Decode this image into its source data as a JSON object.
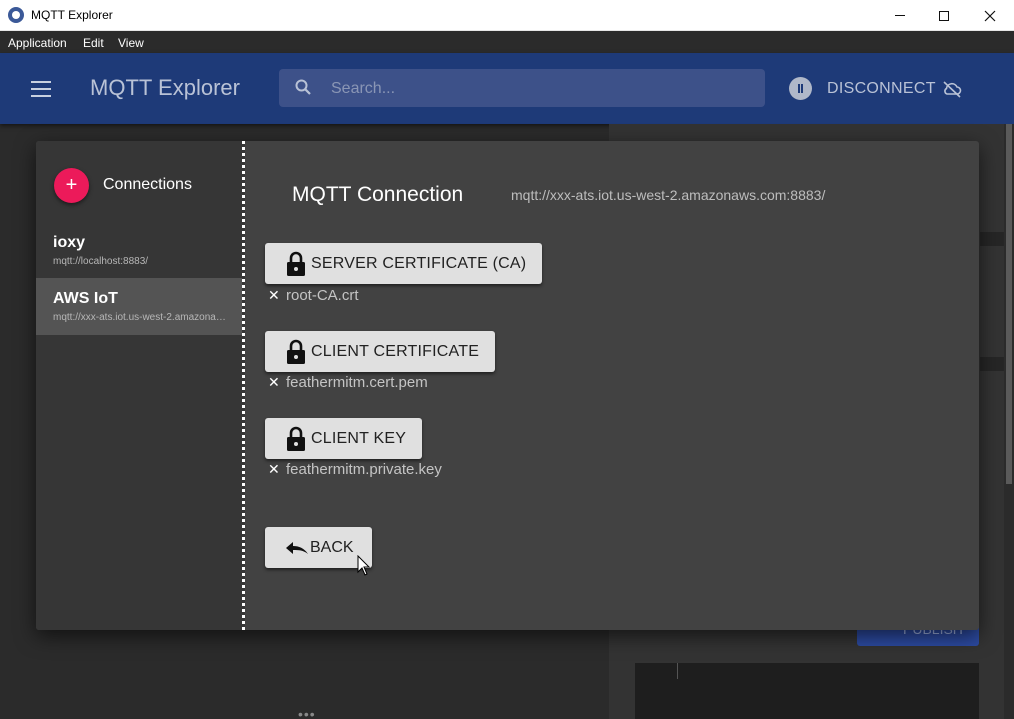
{
  "window": {
    "title": "MQTT Explorer"
  },
  "menu": [
    "Application",
    "Edit",
    "View"
  ],
  "appbar": {
    "title": "MQTT Explorer",
    "search_placeholder": "Search...",
    "disconnect_label": "DISCONNECT"
  },
  "connections": {
    "heading": "Connections",
    "add_label": "+",
    "items": [
      {
        "name": "ioxy",
        "url": "mqtt://localhost:8883/"
      },
      {
        "name": "AWS IoT",
        "url": "mqtt://xxx-ats.iot.us-west-2.amazonaws.com:8883/"
      }
    ]
  },
  "dialog": {
    "title": "MQTT Connection",
    "url": "mqtt://xxx-ats.iot.us-west-2.amazonaws.com:8883/",
    "server_cert_label": "SERVER CERTIFICATE (CA)",
    "server_cert_file": "root-CA.crt",
    "client_cert_label": "CLIENT CERTIFICATE",
    "client_cert_file": "feathermitm.cert.pem",
    "client_key_label": "CLIENT KEY",
    "client_key_file": "feathermitm.private.key",
    "back_label": "BACK",
    "remove_symbol": "✕"
  },
  "background": {
    "publish_label": "PUBLISH",
    "dots": "•••"
  },
  "colors": {
    "appbar": "#1e3a78",
    "accent_pink": "#ec1a5a",
    "dialog_bg": "#424242",
    "sidebar_bg": "#363636"
  }
}
